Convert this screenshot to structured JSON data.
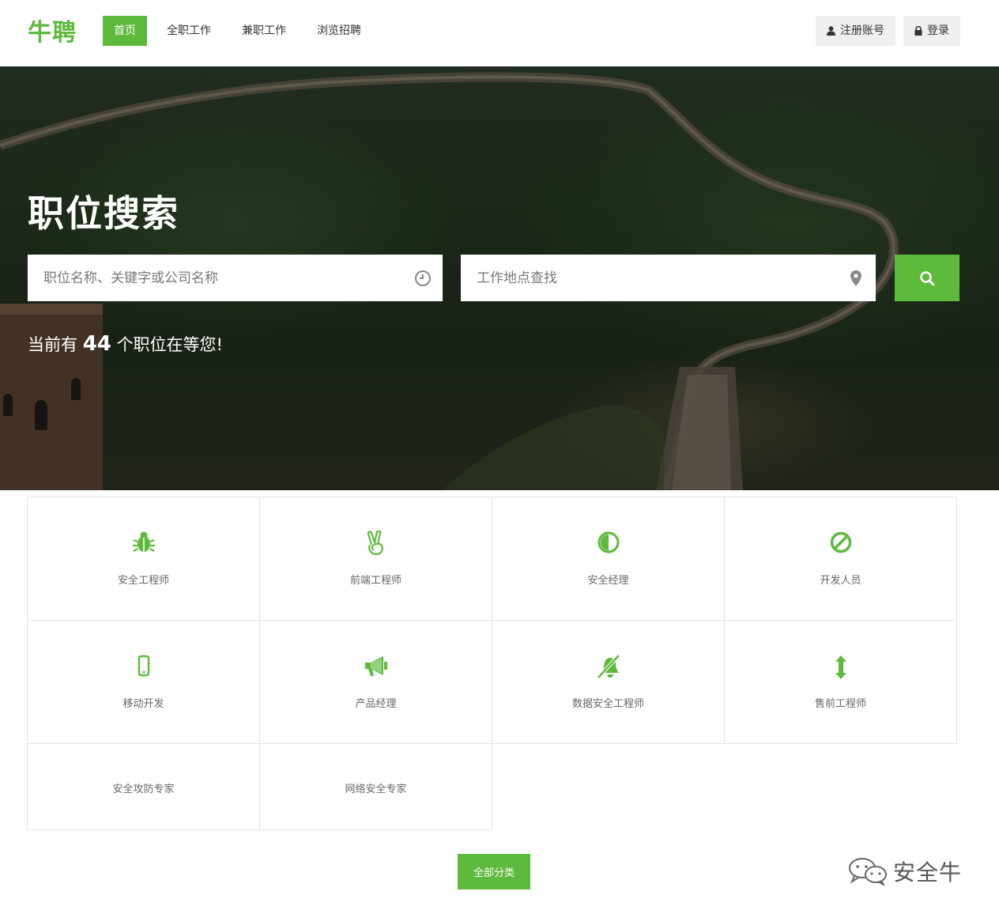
{
  "brand": {
    "name": "牛聘",
    "accent": "#5dba3c"
  },
  "nav": {
    "items": [
      {
        "label": "首页",
        "active": true
      },
      {
        "label": "全职工作",
        "active": false
      },
      {
        "label": "兼职工作",
        "active": false
      },
      {
        "label": "浏览招聘",
        "active": false
      }
    ]
  },
  "auth": {
    "register_label": "注册账号",
    "register_icon": "user-icon",
    "login_label": "登录",
    "login_icon": "lock-icon"
  },
  "hero": {
    "title": "职位搜索",
    "keyword_placeholder": "职位名称、关键字或公司名称",
    "keyword_icon": "clock-icon",
    "location_placeholder": "工作地点查找",
    "location_icon": "map-marker-icon",
    "search_icon": "search-icon",
    "count_prefix": "当前有",
    "count_value": "44",
    "count_suffix": "个职位在等您!"
  },
  "categories": [
    {
      "label": "安全工程师",
      "icon": "bug-icon"
    },
    {
      "label": "前端工程师",
      "icon": "victory-hand-icon"
    },
    {
      "label": "安全经理",
      "icon": "half-circle-icon"
    },
    {
      "label": "开发人员",
      "icon": "ban-icon"
    },
    {
      "label": "移动开发",
      "icon": "mobile-icon"
    },
    {
      "label": "产品经理",
      "icon": "bullhorn-icon"
    },
    {
      "label": "数据安全工程师",
      "icon": "bell-slash-icon"
    },
    {
      "label": "售前工程师",
      "icon": "arrows-vertical-icon"
    },
    {
      "label": "安全攻防专家",
      "icon": ""
    },
    {
      "label": "网络安全专家",
      "icon": ""
    }
  ],
  "all_categories_label": "全部分类",
  "watermark": {
    "text": "安全牛",
    "icon": "wechat-icon"
  }
}
